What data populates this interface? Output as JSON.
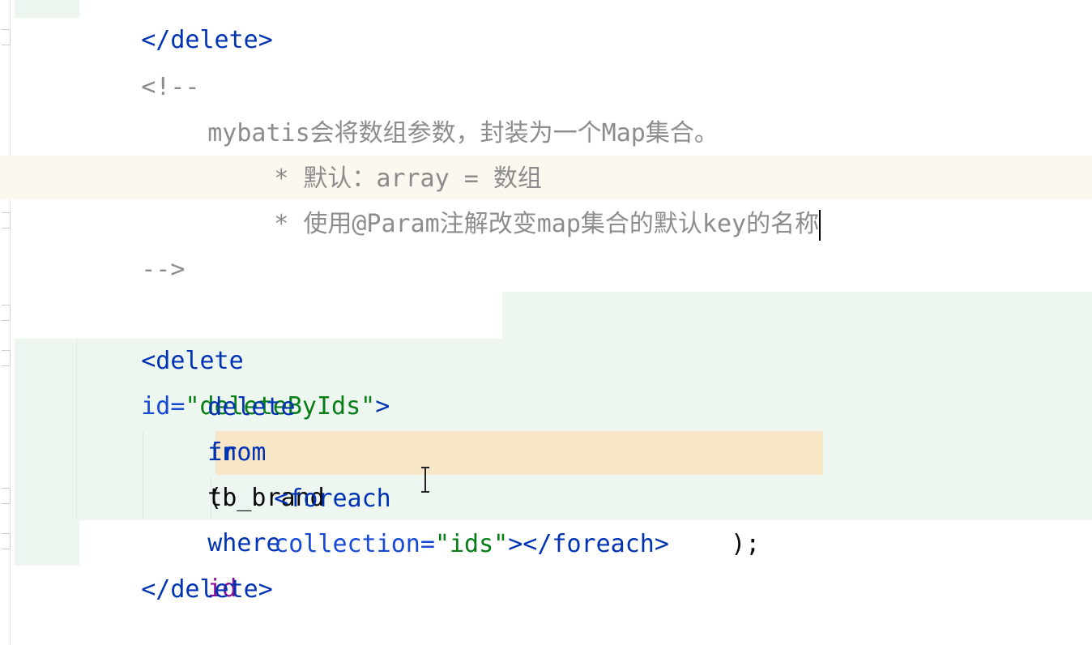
{
  "code": {
    "line0": "</delete>",
    "comment_open": "<!--",
    "comment_text": "mybatis会将数组参数，封装为一个Map集合。",
    "comment_bullet1": "* 默认：array = 数组",
    "comment_bullet2": "* 使用@Param注解改变map集合的默认key的名称",
    "comment_close": "-->",
    "delete_open_tag": "<delete",
    "delete_attr_name": "id=",
    "delete_attr_value": "\"deleteByIds\"",
    "delete_open_close": ">",
    "sql_kw_delete": "delete",
    "sql_kw_from": "from",
    "sql_table": "tb_brand",
    "sql_kw_where": "where",
    "sql_col_id": "id",
    "sql_kw_in": "in",
    "sql_paren_open": "(",
    "foreach_open": "<foreach",
    "foreach_attr": "collection=",
    "foreach_value": "\"ids\"",
    "foreach_close": "></foreach>",
    "paren_close": ");",
    "delete_close_tag": "</delete>"
  },
  "colors": {
    "tag": "#0033b3",
    "attribute": "#174ad4",
    "string": "#067d17",
    "comment": "#8c8c8c",
    "keyword": "#0033b3",
    "column": "#871094",
    "diff_added_bg": "#eef7ef",
    "tag_highlight_bg": "#f7e7c7"
  },
  "icons": {
    "fold_marker": "fold-marker-icon",
    "text_cursor": "i-beam-cursor-icon"
  }
}
